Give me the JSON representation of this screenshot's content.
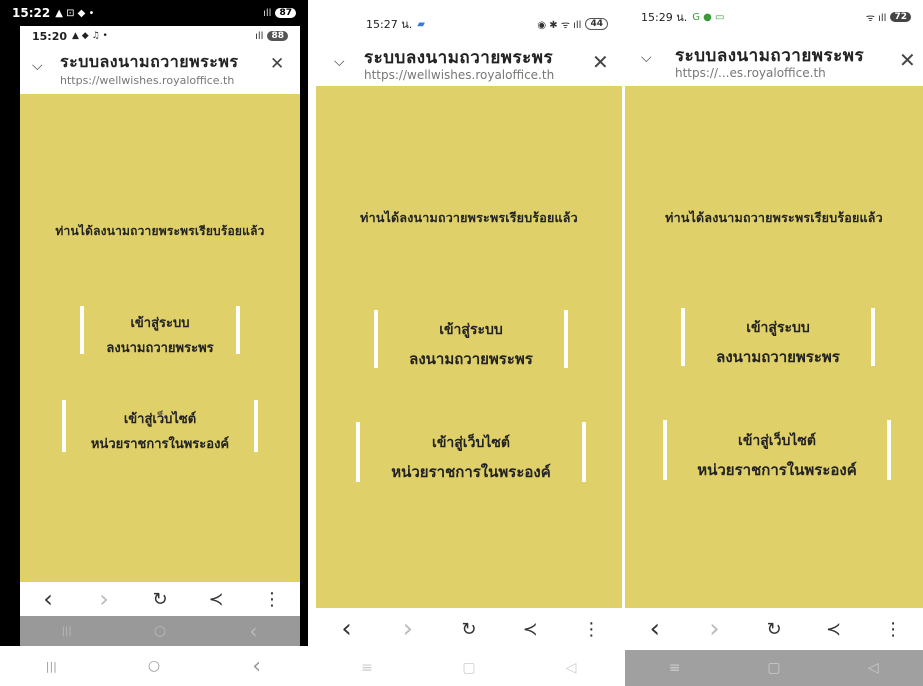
{
  "title": "ระบบลงนามถวายพระพร",
  "message": "ท่านได้ลงนามถวายพระพรเรียบร้อยแล้ว",
  "button_sign": {
    "line1": "เข้าสู่ระบบ",
    "line2": "ลงนามถวายพระพร"
  },
  "button_site": {
    "line1": "เข้าสู่เว็บไซต์",
    "line2": "หน่วยราชการในพระองค์"
  },
  "icons": {
    "chevron": "⌵",
    "close": "✕",
    "back": "‹",
    "forward": "›",
    "reload": "↻",
    "share": "≺",
    "menu": "⋮",
    "recents": "|||",
    "home": "○",
    "navback": "‹"
  },
  "screens": [
    {
      "outer_time": "15:22",
      "outer_status_icons": "▲ ⊡ ◆ •",
      "outer_battery": "87",
      "time": "15:20",
      "status_icons": "▲ ◆ ♫ •",
      "battery": "88",
      "url": "https://wellwishes.royaloffice.th"
    },
    {
      "time": "15:27 น.",
      "status_icons": "◉ ✱ ᯤ ıll",
      "battery": "44",
      "url": "https://wellwishes.royaloffice.th"
    },
    {
      "time": "15:29 น.",
      "status_icons": "G ● ▭",
      "right_icons": "ᯤ ıll",
      "battery": "72",
      "url": "https://...es.royaloffice.th"
    }
  ]
}
